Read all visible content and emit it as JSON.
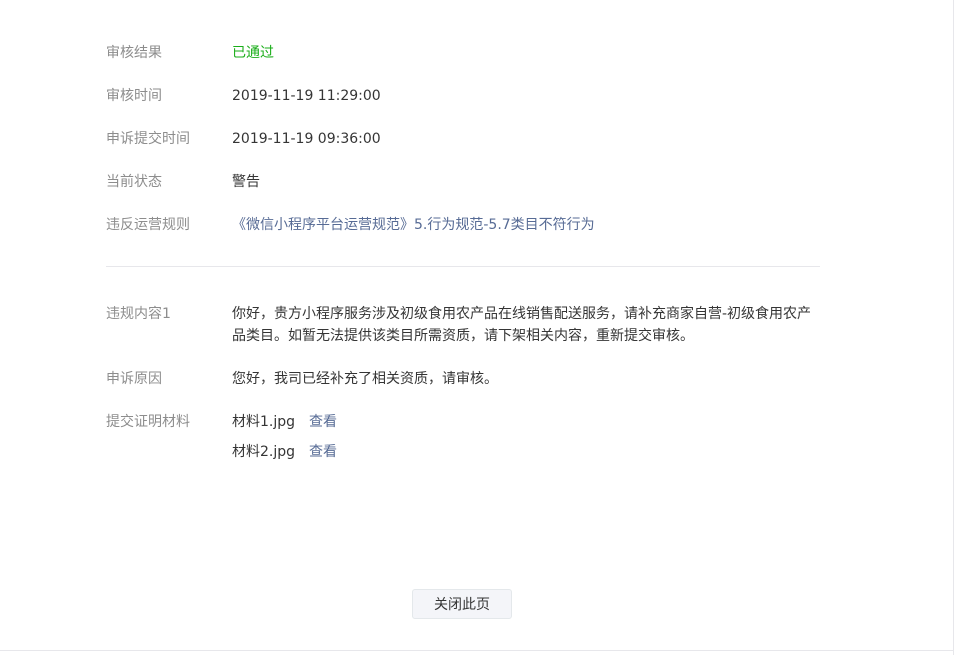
{
  "review": {
    "result": {
      "label": "审核结果",
      "value": "已通过"
    },
    "time": {
      "label": "审核时间",
      "value": "2019-11-19 11:29:00"
    },
    "appeal_time": {
      "label": "申诉提交时间",
      "value": "2019-11-19 09:36:00"
    },
    "status": {
      "label": "当前状态",
      "value": "警告"
    },
    "rule": {
      "label": "违反运营规则",
      "value": "《微信小程序平台运营规范》5.行为规范-5.7类目不符行为"
    }
  },
  "details": {
    "violation": {
      "label": "违规内容1",
      "value": "你好，贵方小程序服务涉及初级食用农产品在线销售配送服务，请补充商家自营-初级食用农产品类目。如暂无法提供该类目所需资质，请下架相关内容，重新提交审核。"
    },
    "appeal_reason": {
      "label": "申诉原因",
      "value": "您好，我司已经补充了相关资质，请审核。"
    },
    "materials": {
      "label": "提交证明材料",
      "files": [
        {
          "name": "材料1.jpg",
          "action": "查看"
        },
        {
          "name": "材料2.jpg",
          "action": "查看"
        }
      ]
    }
  },
  "footer": {
    "close_label": "关闭此页"
  },
  "colors": {
    "success": "#1aad19",
    "link": "#576b95",
    "label": "#8d8d8d",
    "text": "#353535"
  }
}
